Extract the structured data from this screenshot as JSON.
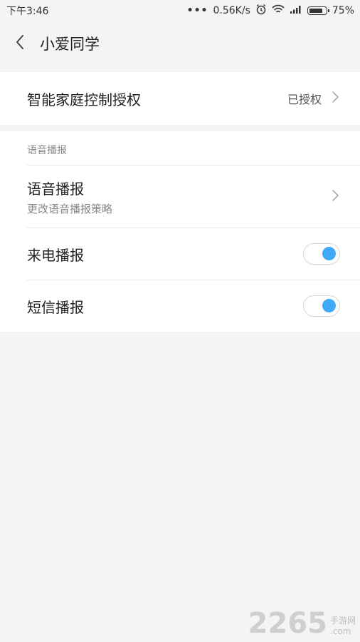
{
  "status_bar": {
    "time": "下午3:46",
    "dots": "•••",
    "speed": "0.56K/s",
    "battery": "75%"
  },
  "header": {
    "title": "小爱同学"
  },
  "home_auth": {
    "label": "智能家庭控制授权",
    "status": "已授权"
  },
  "voice_section": {
    "caption": "语音播报",
    "items": [
      {
        "label": "语音播报",
        "sublabel": "更改语音播报策略"
      },
      {
        "label": "来电播报",
        "toggle_on": true
      },
      {
        "label": "短信播报",
        "toggle_on": true
      }
    ]
  },
  "watermark": {
    "number": "2265",
    "site_cn": "手游网",
    "site_en": ".com"
  },
  "colors": {
    "accent": "#3fa9f5",
    "background": "#f4f4f4"
  },
  "icons": [
    "back-arrow-icon",
    "chevron-right-icon",
    "alarm-icon",
    "wifi-icon",
    "signal-icon",
    "battery-icon"
  ]
}
